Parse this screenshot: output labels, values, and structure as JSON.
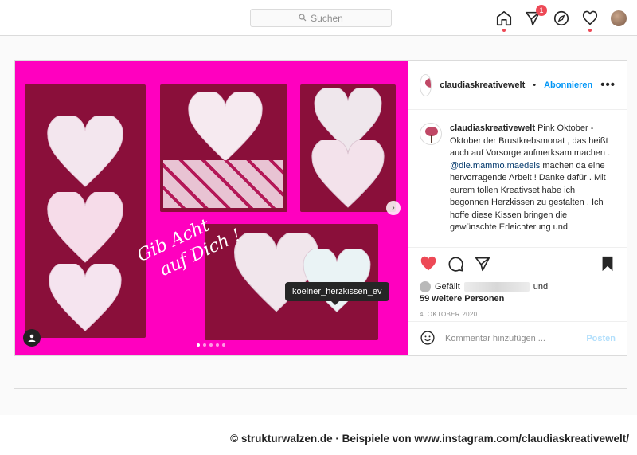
{
  "search": {
    "placeholder": "Suchen"
  },
  "nav": {
    "notification_count": "1"
  },
  "post": {
    "username": "claudiaskreativewelt",
    "follow_label": "Abonnieren",
    "more_label": "•••",
    "caption_user": "claudiaskreativewelt",
    "caption_text_1": " Pink Oktober - Oktober der Brustkrebsmonat , das heißt auch auf Vorsorge aufmerksam machen .",
    "caption_mention": "@die.mammo.maedels",
    "caption_text_2": " machen da eine hervorragende Arbeit ! Danke dafür . Mit eurem tollen Kreativset habe ich begonnen Herzkissen zu gestalten . Ich hoffe diese Kissen bringen die gewünschte Erleichterung und",
    "likes_prefix": "Gefällt",
    "likes_mid": "und",
    "likes_rest": "59 weitere Personen",
    "date": "4. OKTOBER 2020",
    "comment_placeholder": "Kommentar hinzufügen ...",
    "post_button": "Posten",
    "tag_tooltip": "koelner_herzkissen_ev",
    "handwriting_1": "Gib Acht",
    "handwriting_2": "auf Dich !",
    "media_next": "›"
  },
  "footer": {
    "credit": "© strukturwalzen.de · Beispiele von www.instagram.com/claudiaskreativewelt/"
  },
  "colors": {
    "accent": "#0095f6",
    "like": "#ed4956",
    "magenta": "#ff00bf"
  }
}
